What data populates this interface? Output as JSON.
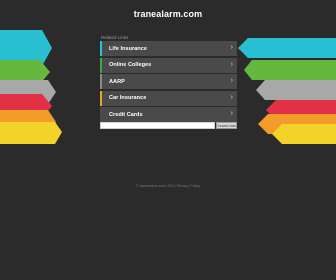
{
  "site": {
    "title": "tranealarm.com"
  },
  "related_label": "Related Links",
  "links": [
    {
      "label": "Life Insurance",
      "accent": "#1ec8d8"
    },
    {
      "label": "Online Colleges",
      "accent": "#37a84b"
    },
    {
      "label": "AARP",
      "accent": "#8a8a8a"
    },
    {
      "label": "Car Insurance",
      "accent": "#e5a62a"
    },
    {
      "label": "Credit Cards",
      "accent": "#4a4a4a"
    }
  ],
  "search": {
    "placeholder": "",
    "button_label": "Search Ads"
  },
  "footer": {
    "text": "© tranealarm.com 2021 Privacy Policy"
  },
  "stripe_colors": [
    "#29bfd2",
    "#63b83d",
    "#a8a8a8",
    "#e23146",
    "#f39c2b",
    "#f3d329"
  ]
}
